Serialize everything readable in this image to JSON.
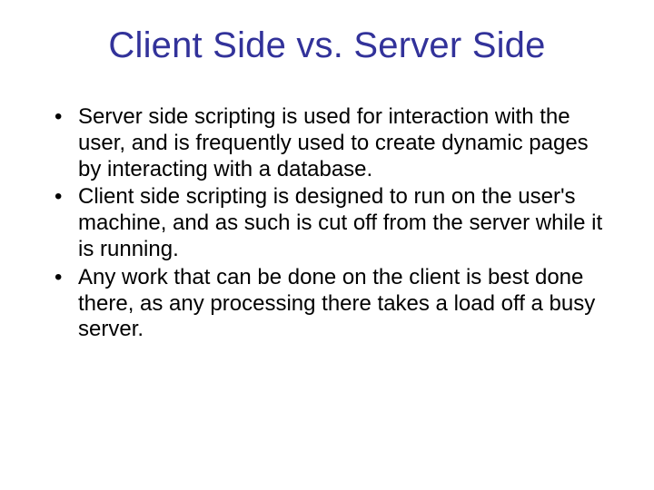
{
  "slide": {
    "title": "Client Side vs. Server Side",
    "bullets": [
      "Server side scripting is used for interaction with the user, and is frequently used to create dynamic pages by interacting with a database.",
      "Client side scripting is designed to run on the user's machine, and as such is cut off from the server while it is running.",
      "Any work that can be done on the client is best done there, as any processing there takes a load off a busy server."
    ]
  }
}
